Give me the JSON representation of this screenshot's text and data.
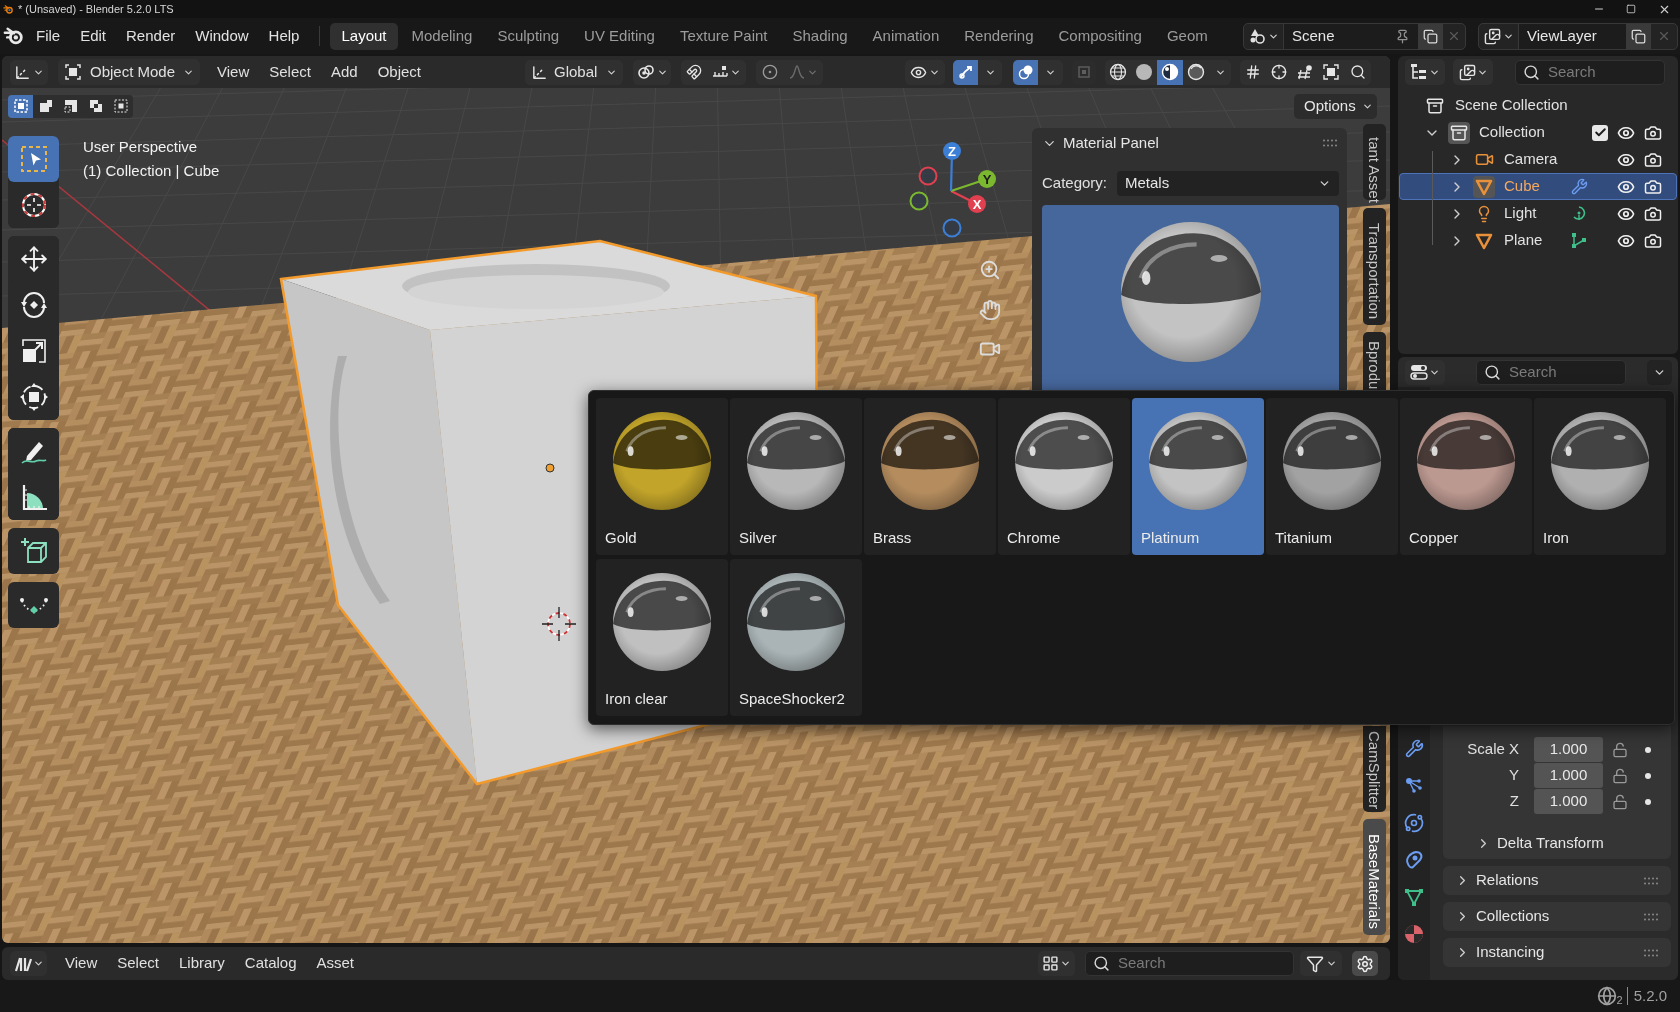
{
  "title_bar": {
    "title": "* (Unsaved) - Blender 5.2.0 LTS"
  },
  "menu_bar": {
    "menus": [
      "File",
      "Edit",
      "Render",
      "Window",
      "Help"
    ],
    "workspaces": [
      {
        "label": "Layout",
        "selected": true
      },
      {
        "label": "Modeling",
        "selected": false
      },
      {
        "label": "Sculpting",
        "selected": false
      },
      {
        "label": "UV Editing",
        "selected": false
      },
      {
        "label": "Texture Paint",
        "selected": false
      },
      {
        "label": "Shading",
        "selected": false
      },
      {
        "label": "Animation",
        "selected": false
      },
      {
        "label": "Rendering",
        "selected": false
      },
      {
        "label": "Compositing",
        "selected": false
      },
      {
        "label": "Geom",
        "selected": false
      }
    ],
    "scene": "Scene",
    "view_layer": "ViewLayer"
  },
  "viewport_header": {
    "mode": "Object Mode",
    "menus": [
      "View",
      "Select",
      "Add",
      "Object"
    ],
    "orientation": "Global",
    "gizmos_on": true,
    "overlays_on": true,
    "xray_on": false,
    "shading_modes": [
      {
        "kind": "wireframe",
        "selected": false
      },
      {
        "kind": "solid",
        "selected": false
      },
      {
        "kind": "material",
        "selected": true
      },
      {
        "kind": "rendered",
        "selected": false
      }
    ]
  },
  "tool_header": {
    "select_modes": [
      {
        "kind": "set",
        "selected": true
      },
      {
        "kind": "extend",
        "selected": false
      },
      {
        "kind": "subtract",
        "selected": false
      },
      {
        "kind": "invert",
        "selected": false
      },
      {
        "kind": "intersect",
        "selected": false
      }
    ],
    "options": "Options"
  },
  "toolbar": {
    "groups": [
      {
        "tools": [
          {
            "kind": "select_box",
            "selected": true
          },
          {
            "kind": "cursor",
            "selected": false
          }
        ]
      },
      {
        "tools": [
          {
            "kind": "move",
            "selected": false
          },
          {
            "kind": "rotate",
            "selected": false
          },
          {
            "kind": "scale",
            "selected": false
          },
          {
            "kind": "transform",
            "selected": false
          }
        ]
      },
      {
        "tools": [
          {
            "kind": "annotate",
            "selected": false
          },
          {
            "kind": "measure",
            "selected": false
          }
        ]
      },
      {
        "tools": [
          {
            "kind": "add_cube",
            "selected": false
          }
        ]
      },
      {
        "tools": [
          {
            "kind": "curve",
            "selected": false
          }
        ]
      }
    ]
  },
  "viewport": {
    "view_name": "User Perspective",
    "context": "(1) Collection | Cube",
    "gizmo_axes": [
      "X",
      "Y",
      "Z"
    ]
  },
  "material_panel": {
    "title": "Material Panel",
    "expanded": true,
    "category_label": "Category:",
    "category": "Metals"
  },
  "sidebar_tabs": {
    "upper": [
      {
        "label": "tant Asset",
        "selected": false
      },
      {
        "label": "Transportation",
        "selected": false
      },
      {
        "label": "Bprodu",
        "selected": false
      }
    ],
    "lower": [
      {
        "label": "CamSplitter",
        "selected": false
      },
      {
        "label": "BaseMaterials",
        "selected": true
      }
    ]
  },
  "material_picker": {
    "items": [
      {
        "name": "Gold",
        "color": "#c2a42a",
        "selected": false
      },
      {
        "name": "Silver",
        "color": "#b8b8b8",
        "selected": false
      },
      {
        "name": "Brass",
        "color": "#b48c5e",
        "selected": false
      },
      {
        "name": "Chrome",
        "color": "#cbcbcb",
        "selected": false
      },
      {
        "name": "Platinum",
        "color": "#c3c3c3",
        "selected": true
      },
      {
        "name": "Titanium",
        "color": "#a2a2a2",
        "selected": false
      },
      {
        "name": "Copper",
        "color": "#bb9890",
        "selected": false
      },
      {
        "name": "Iron",
        "color": "#b0b0b0",
        "selected": false
      },
      {
        "name": "Iron clear",
        "color": "#c0c0c0",
        "selected": false
      },
      {
        "name": "SpaceShocker2",
        "color": "#aab4b6",
        "selected": false
      }
    ]
  },
  "outliner": {
    "search": {
      "placeholder": "Search"
    },
    "tree": [
      {
        "name": "Scene Collection",
        "kind": "scene_collection",
        "selected": false,
        "children": [
          {
            "name": "Collection",
            "kind": "collection",
            "expanded": true,
            "checked": true,
            "active": true,
            "selected": false,
            "children": [
              {
                "name": "Camera",
                "kind": "camera",
                "expanded": false,
                "active": false,
                "selected": false
              },
              {
                "name": "Cube",
                "kind": "mesh",
                "data_icon": {
                  "kind": "modifier"
                },
                "expanded": false,
                "active": true,
                "selected": true
              },
              {
                "name": "Light",
                "kind": "light",
                "data_icon": {
                  "kind": "light"
                },
                "expanded": false,
                "active": false,
                "selected": false
              },
              {
                "name": "Plane",
                "kind": "mesh",
                "data_icon": {
                  "kind": "mesh"
                },
                "expanded": false,
                "active": false,
                "selected": false
              }
            ]
          }
        ]
      }
    ]
  },
  "properties": {
    "search": {
      "placeholder": "Search"
    },
    "tabs": [
      {
        "kind": "modifiers"
      },
      {
        "kind": "particles"
      },
      {
        "kind": "physics"
      },
      {
        "kind": "constraints"
      },
      {
        "kind": "data"
      },
      {
        "kind": "material"
      }
    ],
    "transform": {
      "rows": [
        {
          "label": "Scale X",
          "value": "1.000",
          "locked": false
        },
        {
          "label": "Y",
          "value": "1.000",
          "locked": false
        },
        {
          "label": "Z",
          "value": "1.000",
          "locked": false
        }
      ],
      "subpanel": {
        "title": "Delta Transform",
        "expanded": false
      }
    },
    "panels": [
      {
        "title": "Relations",
        "expanded": false
      },
      {
        "title": "Collections",
        "expanded": false
      },
      {
        "title": "Instancing",
        "expanded": false
      }
    ]
  },
  "asset_browser": {
    "menus": [
      "View",
      "Select",
      "Library",
      "Catalog",
      "Asset"
    ],
    "search": {
      "placeholder": "Search"
    }
  },
  "status_bar": {
    "extension_updates": "2",
    "version": "5.2.0"
  }
}
